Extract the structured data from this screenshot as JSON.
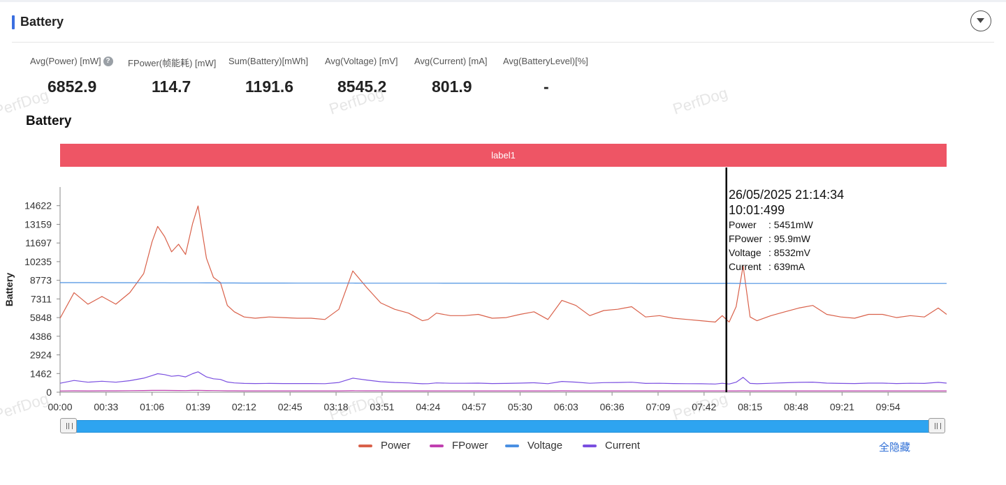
{
  "header": {
    "title": "Battery"
  },
  "stats": [
    {
      "label": "Avg(Power) [mW]",
      "value": "6852.9",
      "help": true
    },
    {
      "label": "FPower(帧能耗) [mW]",
      "value": "114.7"
    },
    {
      "label": "Sum(Battery)[mWh]",
      "value": "1191.6"
    },
    {
      "label": "Avg(Voltage) [mV]",
      "value": "8545.2"
    },
    {
      "label": "Avg(Current) [mA]",
      "value": "801.9"
    },
    {
      "label": "Avg(BatteryLevel)[%]",
      "value": "-"
    }
  ],
  "watermark": "PerfDog",
  "chart": {
    "title": "Battery",
    "label_band": "label1",
    "ylabel": "Battery",
    "legend_hide_all": "全隐藏",
    "tooltip": {
      "datetime": "26/05/2025 21:14:34",
      "elapsed": "10:01:499",
      "rows": [
        {
          "key": "Power",
          "value": "5451mW"
        },
        {
          "key": "FPower",
          "value": "95.9mW"
        },
        {
          "key": "Voltage",
          "value": "8532mV"
        },
        {
          "key": "Current",
          "value": "639mA"
        }
      ]
    }
  },
  "chart_data": {
    "type": "line",
    "ylabel": "Battery",
    "y_ticks": [
      0,
      1462,
      2924,
      4386,
      5848,
      7311,
      8773,
      10235,
      11697,
      13159,
      14622
    ],
    "ylim": [
      0,
      16084
    ],
    "x_ticks": [
      "00:00",
      "00:33",
      "01:06",
      "01:39",
      "02:12",
      "02:45",
      "03:18",
      "03:51",
      "04:24",
      "04:57",
      "05:30",
      "06:03",
      "06:36",
      "07:09",
      "07:42",
      "08:15",
      "08:48",
      "09:21",
      "09:54"
    ],
    "xlim_seconds": [
      0,
      636
    ],
    "grid": false,
    "legend_placement": "bottom",
    "cursor_time": "07:58",
    "x": [
      0,
      10,
      20,
      30,
      40,
      50,
      60,
      66,
      70,
      75,
      80,
      85,
      90,
      95,
      99,
      105,
      110,
      115,
      120,
      125,
      132,
      140,
      150,
      160,
      170,
      180,
      190,
      200,
      210,
      220,
      230,
      240,
      250,
      255,
      260,
      264,
      270,
      280,
      290,
      300,
      310,
      320,
      330,
      340,
      350,
      360,
      370,
      380,
      390,
      400,
      410,
      420,
      430,
      440,
      450,
      460,
      470,
      475,
      480,
      485,
      490,
      495,
      500,
      510,
      520,
      530,
      540,
      550,
      560,
      570,
      580,
      590,
      600,
      610,
      620,
      630,
      636
    ],
    "series": [
      {
        "name": "Power",
        "color": "#d9614a",
        "values": [
          5800,
          7800,
          6900,
          7500,
          6900,
          7800,
          9300,
          11800,
          13000,
          12200,
          11000,
          11600,
          10800,
          13200,
          14600,
          10500,
          9000,
          8600,
          6800,
          6300,
          5900,
          5800,
          5900,
          5850,
          5800,
          5800,
          5700,
          6500,
          9500,
          8200,
          7000,
          6500,
          6200,
          5900,
          5600,
          5700,
          6200,
          6000,
          6000,
          6100,
          5800,
          5850,
          6100,
          6300,
          5700,
          7200,
          6800,
          6000,
          6400,
          6500,
          6700,
          5900,
          6000,
          5800,
          5700,
          5600,
          5500,
          6000,
          5500,
          6700,
          9900,
          5900,
          5600,
          6000,
          6300,
          6600,
          6800,
          6100,
          5900,
          5800,
          6100,
          6100,
          5850,
          6000,
          5900,
          6600,
          6100
        ]
      },
      {
        "name": "FPower",
        "color": "#c040b0",
        "values": [
          100,
          110,
          105,
          108,
          112,
          118,
          130,
          140,
          145,
          140,
          135,
          132,
          128,
          140,
          150,
          130,
          125,
          118,
          110,
          108,
          105,
          105,
          104,
          104,
          104,
          104,
          104,
          106,
          115,
          112,
          108,
          106,
          105,
          104,
          103,
          103,
          105,
          104,
          104,
          104,
          104,
          104,
          104,
          106,
          103,
          108,
          106,
          104,
          105,
          106,
          106,
          104,
          104,
          104,
          103,
          103,
          103,
          103,
          103,
          104,
          110,
          103,
          103,
          104,
          105,
          106,
          106,
          104,
          104,
          104,
          104,
          104,
          104,
          104,
          104,
          105,
          104
        ]
      },
      {
        "name": "Voltage",
        "color": "#4a90e2",
        "values": [
          8590,
          8590,
          8590,
          8585,
          8585,
          8585,
          8580,
          8578,
          8577,
          8576,
          8575,
          8574,
          8573,
          8572,
          8571,
          8568,
          8566,
          8564,
          8562,
          8560,
          8558,
          8556,
          8555,
          8554,
          8553,
          8552,
          8551,
          8550,
          8549,
          8548,
          8547,
          8546,
          8545,
          8545,
          8544,
          8544,
          8543,
          8542,
          8541,
          8540,
          8539,
          8538,
          8537,
          8537,
          8536,
          8535,
          8534,
          8533,
          8533,
          8532,
          8532,
          8531,
          8530,
          8530,
          8529,
          8529,
          8528,
          8528,
          8532,
          8527,
          8527,
          8526,
          8526,
          8526,
          8525,
          8525,
          8524,
          8524,
          8524,
          8523,
          8523,
          8523,
          8522,
          8522,
          8522,
          8521,
          8521
        ]
      },
      {
        "name": "Current",
        "color": "#7a4fe0",
        "values": [
          700,
          920,
          780,
          860,
          780,
          900,
          1100,
          1300,
          1450,
          1380,
          1250,
          1300,
          1200,
          1450,
          1600,
          1200,
          1050,
          1000,
          800,
          730,
          690,
          680,
          690,
          680,
          680,
          680,
          670,
          760,
          1100,
          950,
          820,
          760,
          730,
          690,
          660,
          670,
          730,
          700,
          700,
          710,
          680,
          690,
          710,
          740,
          670,
          840,
          790,
          700,
          750,
          760,
          780,
          690,
          700,
          680,
          670,
          660,
          640,
          700,
          640,
          780,
          1160,
          690,
          660,
          700,
          740,
          770,
          790,
          710,
          690,
          680,
          710,
          710,
          680,
          700,
          690,
          770,
          710
        ]
      }
    ]
  }
}
